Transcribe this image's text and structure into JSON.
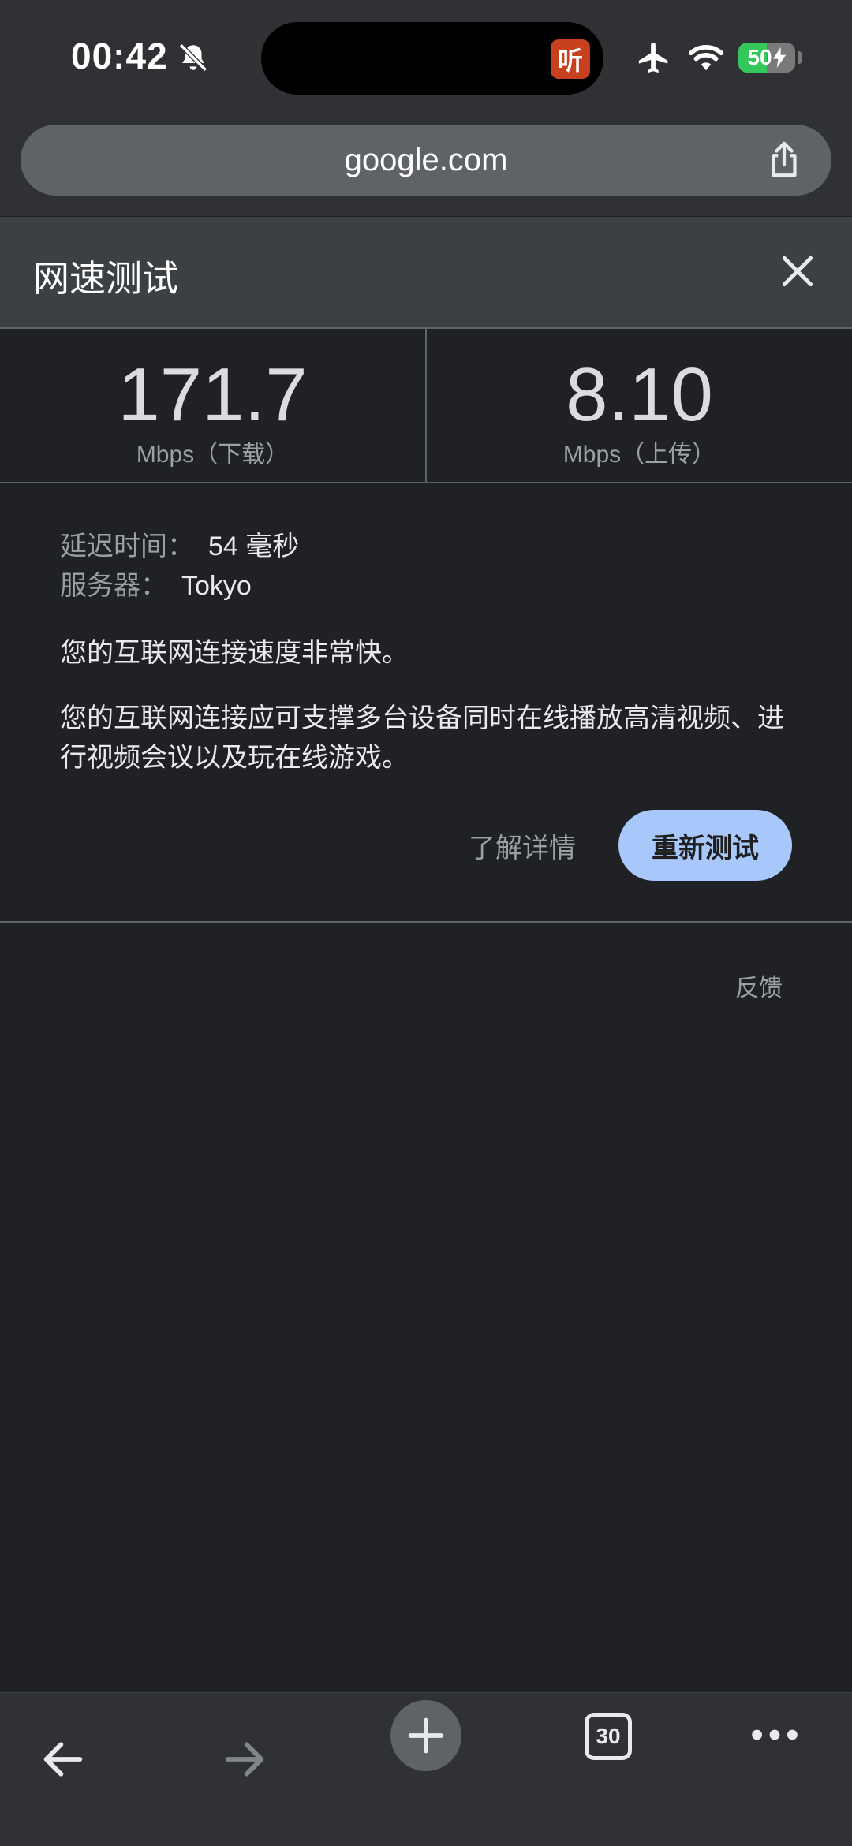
{
  "status_bar": {
    "time": "00:42",
    "listen_app_label": "听",
    "battery_percent": 50,
    "battery_label": "50"
  },
  "address_bar": {
    "url": "google.com"
  },
  "speed_test": {
    "title": "网速测试",
    "download": {
      "value": "171.7",
      "unit": "Mbps（下载）"
    },
    "upload": {
      "value": "8.10",
      "unit": "Mbps（上传）"
    },
    "latency_label": "延迟时间：",
    "latency_value": "54 毫秒",
    "server_label": "服务器：",
    "server_value": "Tokyo",
    "summary": "您的互联网连接速度非常快。",
    "description": "您的互联网连接应可支撑多台设备同时在线播放高清视频、进行视频会议以及玩在线游戏。",
    "learn_more_label": "了解详情",
    "retest_label": "重新测试",
    "feedback_label": "反馈"
  },
  "toolbar": {
    "tab_count": "30"
  },
  "colors": {
    "accent": "#a8c7fa",
    "background": "#202124",
    "chrome": "#303134",
    "battery_green": "#34c759"
  }
}
